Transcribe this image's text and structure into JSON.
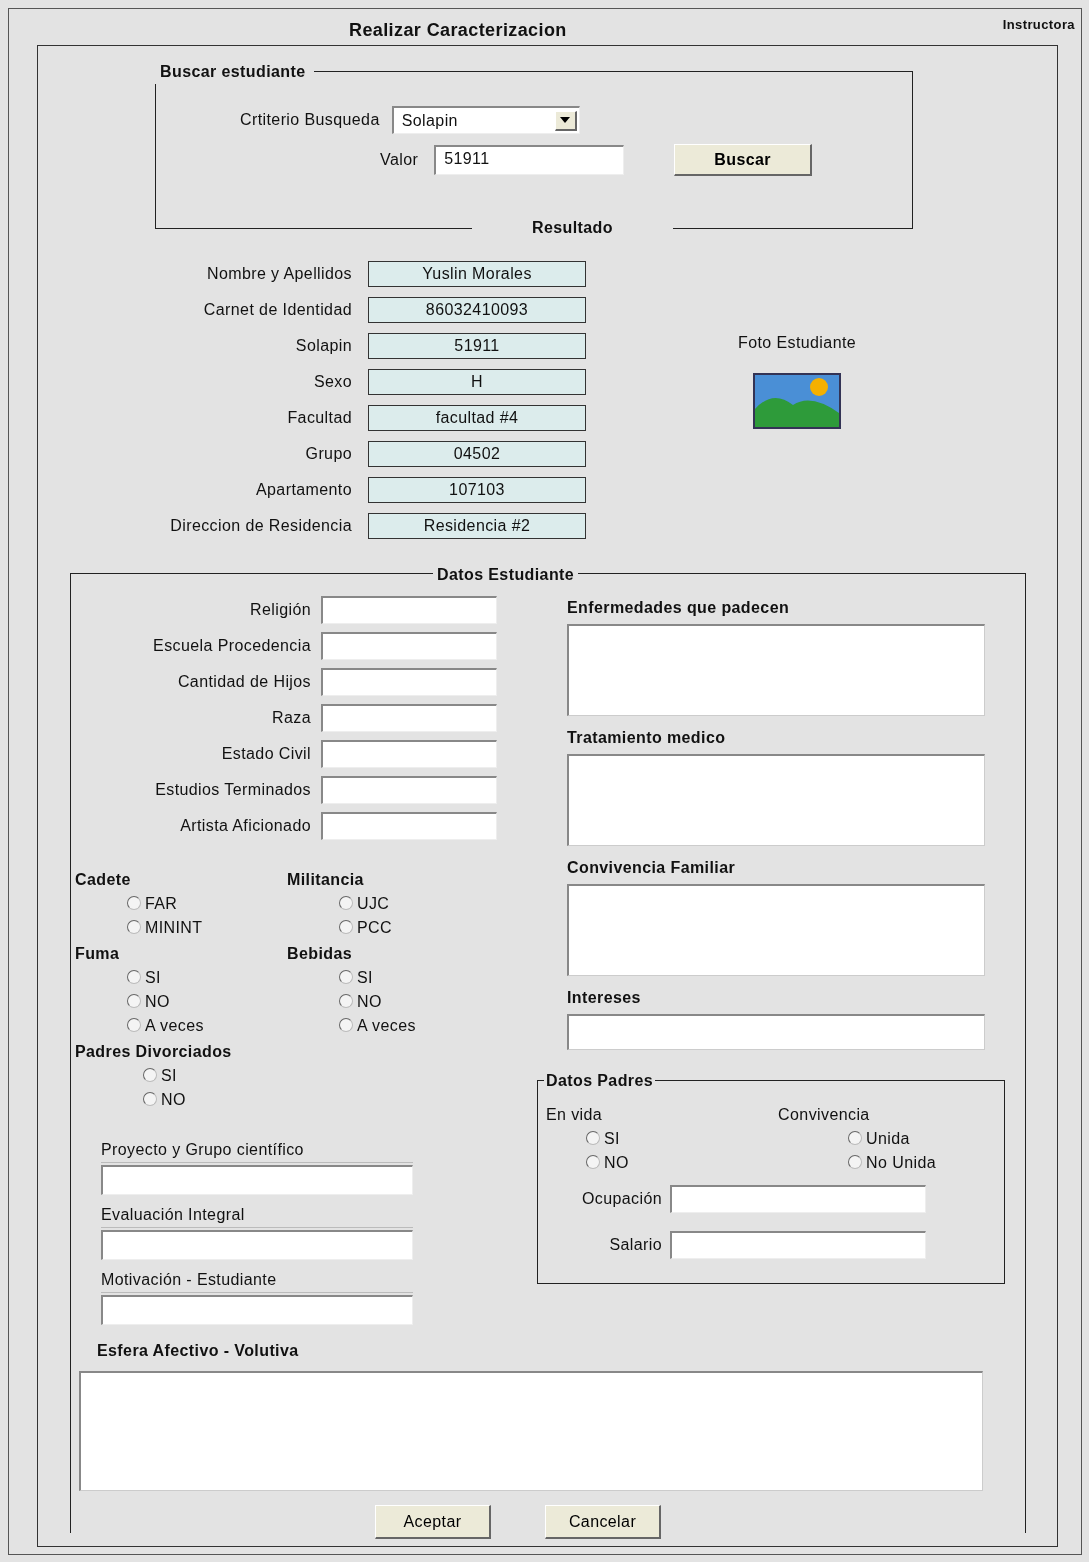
{
  "title": "Realizar Caracterizacion",
  "user": "Instructora",
  "search": {
    "legend": "Buscar estudiante",
    "criterion_label": "Crtiterio Busqueda",
    "criterion_value": "Solapin",
    "value_label": "Valor",
    "value": "51911",
    "button": "Buscar",
    "footer": "Resultado"
  },
  "result": {
    "fields": [
      {
        "label": "Nombre y Apellidos",
        "value": "Yuslin Morales"
      },
      {
        "label": "Carnet de Identidad",
        "value": "86032410093"
      },
      {
        "label": "Solapin",
        "value": "51911"
      },
      {
        "label": "Sexo",
        "value": "H"
      },
      {
        "label": "Facultad",
        "value": "facultad #4"
      },
      {
        "label": "Grupo",
        "value": "04502"
      },
      {
        "label": "Apartamento",
        "value": "107103"
      },
      {
        "label": "Direccion de Residencia",
        "value": "Residencia #2"
      }
    ],
    "photo_label": "Foto Estudiante"
  },
  "student": {
    "legend": "Datos Estudiante",
    "fields": [
      {
        "label": "Religión"
      },
      {
        "label": "Escuela Procedencia"
      },
      {
        "label": "Cantidad de Hijos"
      },
      {
        "label": "Raza"
      },
      {
        "label": "Estado Civil"
      },
      {
        "label": "Estudios Terminados"
      },
      {
        "label": "Artista Aficionado"
      }
    ],
    "radio_groups": [
      {
        "title": "Cadete",
        "options": [
          {
            "label": "FAR",
            "selected": false
          },
          {
            "label": "MININT",
            "selected": false
          }
        ]
      },
      {
        "title": "Militancia",
        "options": [
          {
            "label": "UJC",
            "selected": false
          },
          {
            "label": "PCC",
            "selected": false
          }
        ]
      },
      {
        "title": "Fuma",
        "options": [
          {
            "label": "SI",
            "selected": false
          },
          {
            "label": "NO",
            "selected": false
          },
          {
            "label": "A veces",
            "selected": false
          }
        ]
      },
      {
        "title": "Bebidas",
        "options": [
          {
            "label": "SI",
            "selected": false
          },
          {
            "label": "NO",
            "selected": false
          },
          {
            "label": "A veces",
            "selected": false
          }
        ]
      },
      {
        "title": "Padres Divorciados",
        "options": [
          {
            "label": "SI",
            "selected": false
          },
          {
            "label": "NO",
            "selected": false
          }
        ]
      }
    ],
    "extra_fields": [
      {
        "label": "Proyecto  y Grupo científico"
      },
      {
        "label": "Evaluación Integral"
      },
      {
        "label": "Motivación - Estudiante"
      }
    ],
    "text_areas": [
      {
        "label": "Enfermedades que padecen",
        "kind": "multi"
      },
      {
        "label": "Tratamiento medico",
        "kind": "multi"
      },
      {
        "label": "Convivencia Familiar",
        "kind": "multi"
      },
      {
        "label": "Intereses",
        "kind": "single"
      }
    ],
    "parents": {
      "legend": "Datos Padres",
      "radio_groups": [
        {
          "title": "En vida",
          "options": [
            {
              "label": "SI",
              "selected": false
            },
            {
              "label": "NO",
              "selected": false
            }
          ]
        },
        {
          "title": "Convivencia",
          "options": [
            {
              "label": "Unida",
              "selected": false
            },
            {
              "label": "No Unida",
              "selected": false
            }
          ]
        }
      ],
      "fields": [
        {
          "label": "Ocupación"
        },
        {
          "label": "Salario"
        }
      ]
    },
    "notes": {
      "label": "Esfera Afectivo - Volutiva"
    }
  },
  "buttons": [
    "Aceptar",
    "Cancelar"
  ]
}
